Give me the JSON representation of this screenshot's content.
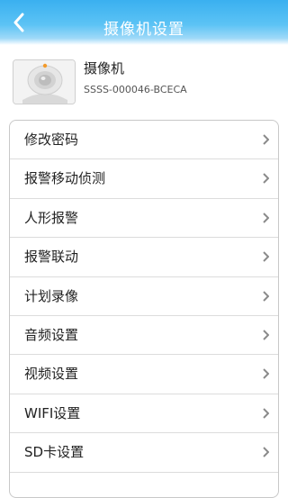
{
  "header": {
    "title": "摄像机设置",
    "back_icon": "chevron-left-icon"
  },
  "device": {
    "name": "摄像机",
    "id": "SSSS-000046-BCECA",
    "thumbnail_icon": "webcam-icon"
  },
  "menu": {
    "chevron_icon": "chevron-right-icon",
    "items": [
      {
        "label": "修改密码"
      },
      {
        "label": "报警移动侦测"
      },
      {
        "label": "人形报警"
      },
      {
        "label": "报警联动"
      },
      {
        "label": "计划录像"
      },
      {
        "label": "音频设置"
      },
      {
        "label": "视频设置"
      },
      {
        "label": "WIFI设置"
      },
      {
        "label": "SD卡设置"
      }
    ]
  },
  "colors": {
    "header_blue": "#3ab0f0",
    "text": "#222222",
    "border": "#c8c8c8",
    "chevron": "#8a8a8a"
  }
}
